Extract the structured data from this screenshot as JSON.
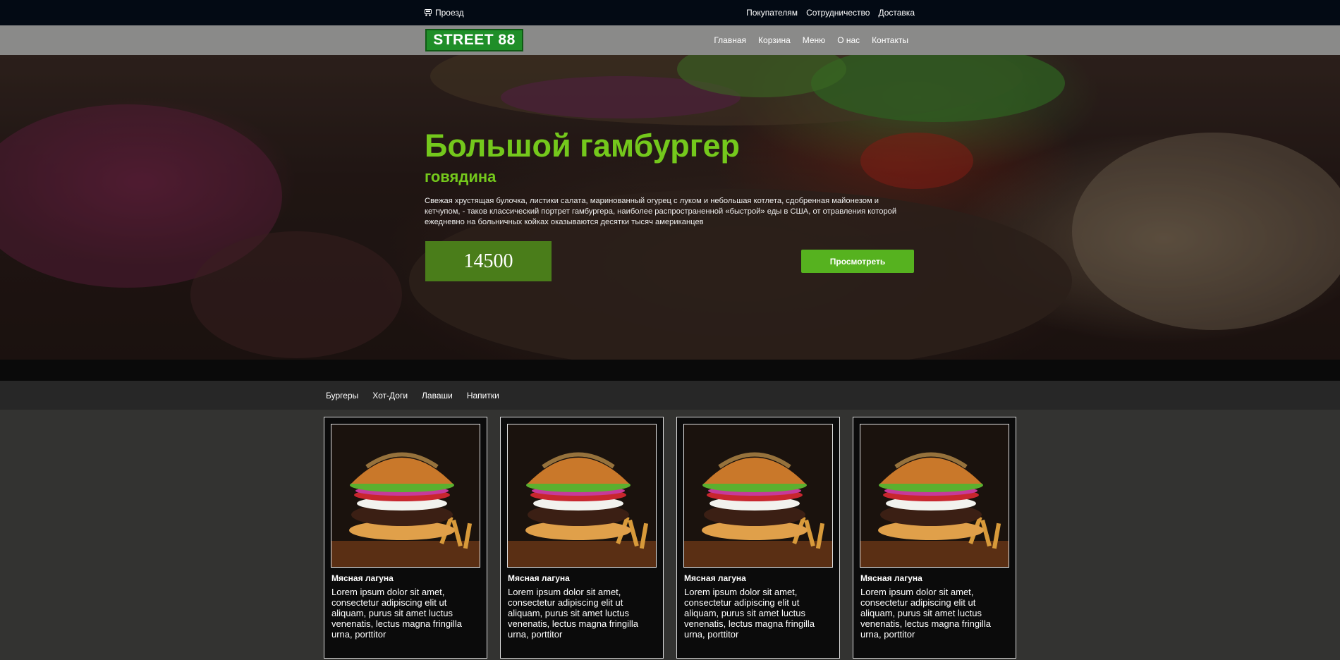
{
  "topbar": {
    "route_label": "Проезд",
    "links": [
      "Покупателям",
      "Сотрудничество",
      "Доставка"
    ]
  },
  "navbar": {
    "logo": "STREET 88",
    "items": [
      "Главная",
      "Корзина",
      "Меню",
      "О нас",
      "Контакты"
    ]
  },
  "hero": {
    "title": "Большой гамбургер",
    "subtitle": "говядина",
    "description": "Свежая хрустящая булочка, листики салата, маринованный огурец с луком и небольшая котлета, сдобренная майонезом и кетчупом, - таков классический портрет гамбургера, наиболее распространенной «быстрой» еды в США, от отравления которой ежедневно на больничных койках оказываются десятки тысяч американцев",
    "price": "14500",
    "view_button": "Просмотреть"
  },
  "categories": [
    "Бургеры",
    "Хот-Доги",
    "Лаваши",
    "Напитки"
  ],
  "cards": [
    {
      "title": "Мясная лагуна",
      "text": "Lorem ipsum dolor sit amet, consectetur adipiscing elit ut aliquam, purus sit amet luctus venenatis, lectus magna fringilla urna, porttitor"
    },
    {
      "title": "Мясная лагуна",
      "text": "Lorem ipsum dolor sit amet, consectetur adipiscing elit ut aliquam, purus sit amet luctus venenatis, lectus magna fringilla urna, porttitor"
    },
    {
      "title": "Мясная лагуна",
      "text": "Lorem ipsum dolor sit amet, consectetur adipiscing elit ut aliquam, purus sit amet luctus venenatis, lectus magna fringilla urna, porttitor"
    },
    {
      "title": "Мясная лагуна",
      "text": "Lorem ipsum dolor sit amet, consectetur adipiscing elit ut aliquam, purus sit amet luctus venenatis, lectus magna fringilla urna, porttitor"
    }
  ],
  "colors": {
    "accent_green": "#74c81c",
    "logo_green": "#1f8e28",
    "button_green": "#56b21f",
    "price_green": "#4a7d1a",
    "topbar": "#030a14",
    "navbar": "#8a8a89"
  },
  "icons": {
    "route": "route-icon",
    "burger": "burger-image"
  }
}
